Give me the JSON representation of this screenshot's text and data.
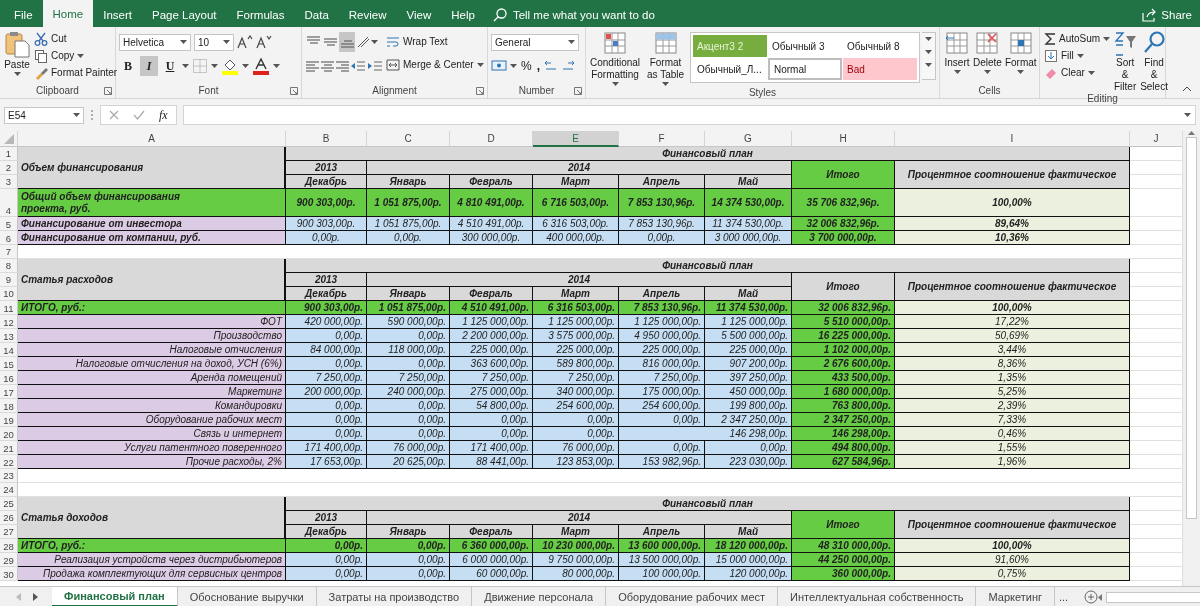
{
  "menu_tabs": [
    {
      "label": "File",
      "selected": false
    },
    {
      "label": "Home",
      "selected": true
    },
    {
      "label": "Insert",
      "selected": false
    },
    {
      "label": "Page Layout",
      "selected": false
    },
    {
      "label": "Formulas",
      "selected": false
    },
    {
      "label": "Data",
      "selected": false
    },
    {
      "label": "Review",
      "selected": false
    },
    {
      "label": "View",
      "selected": false
    },
    {
      "label": "Help",
      "selected": false
    }
  ],
  "tell_me": "Tell me what you want to do",
  "share": "Share",
  "ribbon": {
    "clipboard": {
      "label": "Clipboard",
      "paste": "Paste",
      "cut": "Cut",
      "copy": "Copy",
      "format_painter": "Format Painter"
    },
    "font": {
      "label": "Font",
      "family": "Helvetica",
      "size": "10",
      "styles": [
        {
          "text": "B",
          "kind": "bold",
          "selected": false
        },
        {
          "text": "I",
          "kind": "italic",
          "selected": true
        },
        {
          "text": "U",
          "kind": "underline",
          "selected": false
        }
      ]
    },
    "alignment": {
      "label": "Alignment",
      "vertical_align": [
        {
          "selected": false
        },
        {
          "selected": false
        },
        {
          "selected": true
        }
      ],
      "wrap_text": "Wrap Text",
      "merge_center": "Merge & Center"
    },
    "number": {
      "label": "Number",
      "format": "General",
      "percent": "%",
      "comma": ","
    },
    "styles": {
      "label": "Styles",
      "conditional": "Conditional Formatting",
      "format_table": "Format as Table",
      "gallery": [
        {
          "text": "Акцент3 2",
          "kind": "accent"
        },
        {
          "text": "Обычный 3",
          "kind": "plain"
        },
        {
          "text": "Обычный 8",
          "kind": "plain"
        },
        {
          "text": "Обычный_Л...",
          "kind": "plain"
        },
        {
          "text": "Normal",
          "kind": "normal"
        },
        {
          "text": "Bad",
          "kind": "bad"
        }
      ]
    },
    "cells": {
      "label": "Cells",
      "insert": "Insert",
      "delete": "Delete",
      "format": "Format"
    },
    "editing": {
      "label": "Editing",
      "autosum": "AutoSum",
      "fill": "Fill",
      "clear": "Clear",
      "sort": "Sort & Filter",
      "find": "Find & Select"
    }
  },
  "name_box": "E54",
  "fx": "fx",
  "columns": [
    {
      "label": "A",
      "selected": false
    },
    {
      "label": "B",
      "selected": false
    },
    {
      "label": "C",
      "selected": false
    },
    {
      "label": "D",
      "selected": false
    },
    {
      "label": "E",
      "selected": true
    },
    {
      "label": "F",
      "selected": false
    },
    {
      "label": "G",
      "selected": false
    },
    {
      "label": "H",
      "selected": false
    },
    {
      "label": "I",
      "selected": false
    },
    {
      "label": "J",
      "selected": false
    }
  ],
  "blocks": [
    {
      "header_rows": [
        "1",
        "2",
        "3"
      ],
      "title": "Объем финансирования",
      "plan": "Финансовый план",
      "years": [
        "2013",
        "2014"
      ],
      "months": [
        "Декабрь",
        "Январь",
        "Февраль",
        "Март",
        "Апрель",
        "Май"
      ],
      "total_header": "Итого",
      "total_highlight": true,
      "percent_header": "Процентное соотношение фактическое",
      "rows": [
        {
          "num": "4",
          "kind": "total",
          "tall": true,
          "label": "Общий объем финансирования проекта, руб.",
          "values": [
            "900 303,00р.",
            "1 051 875,00р.",
            "4 810 491,00р.",
            "6 716 503,00р.",
            "7 853 130,96р.",
            "14 374 530,00р."
          ],
          "total": "35 706 832,96р.",
          "percent": "100,00%"
        },
        {
          "num": "5",
          "kind": "source",
          "tall": false,
          "label": "Финансирование от инвестора",
          "values": [
            "900 303,00р.",
            "1 051 875,00р.",
            "4 510 491,00р.",
            "6 316 503,00р.",
            "7 853 130,96р.",
            "11 374 530,00р."
          ],
          "total": "32 006 832,96р.",
          "percent": "89,64%"
        },
        {
          "num": "6",
          "kind": "source",
          "tall": false,
          "label": "Финансирование от компании, руб.",
          "values": [
            "0,00р.",
            "0,00р.",
            "300 000,00р.",
            "400 000,00р.",
            "0,00р.",
            "3 000 000,00р."
          ],
          "total": "3 700 000,00р.",
          "percent": "10,36%"
        }
      ],
      "trailing_rows": [
        "7"
      ]
    },
    {
      "header_rows": [
        "8",
        "9",
        "10"
      ],
      "title": "Статья расходов",
      "plan": "Финансовый план",
      "years": [
        "2013",
        "2014"
      ],
      "months": [
        "Декабрь",
        "Январь",
        "Февраль",
        "Март",
        "Апрель",
        "Май"
      ],
      "total_header": "Итого",
      "total_highlight": false,
      "percent_header": "Процентное соотношение фактическое",
      "rows": [
        {
          "num": "11",
          "kind": "total",
          "tall": false,
          "label": "ИТОГО, руб.:",
          "values": [
            "900 303,00р.",
            "1 051 875,00р.",
            "4 510 491,00р.",
            "6 316 503,00р.",
            "7 853 130,96р.",
            "11 374 530,00р."
          ],
          "total": "32 006 832,96р.",
          "percent": "100,00%"
        },
        {
          "num": "12",
          "kind": "item",
          "tall": false,
          "label": "ФОТ",
          "values": [
            "420 000,00р.",
            "590 000,00р.",
            "1 125 000,00р.",
            "1 125 000,00р.",
            "1 125 000,00р.",
            "1 125 000,00р."
          ],
          "total": "5 510 000,00р.",
          "percent": "17,22%"
        },
        {
          "num": "13",
          "kind": "item",
          "tall": false,
          "label": "Производство",
          "values": [
            "0,00р.",
            "0,00р.",
            "2 200 000,00р.",
            "3 575 000,00р.",
            "4 950 000,00р.",
            "5 500 000,00р."
          ],
          "total": "16 225 000,00р.",
          "percent": "50,69%"
        },
        {
          "num": "14",
          "kind": "item",
          "tall": false,
          "label": "Налоговые отчисления",
          "values": [
            "84 000,00р.",
            "118 000,00р.",
            "225 000,00р.",
            "225 000,00р.",
            "225 000,00р.",
            "225 000,00р."
          ],
          "total": "1 102 000,00р.",
          "percent": "3,44%"
        },
        {
          "num": "15",
          "kind": "item",
          "tall": false,
          "label": "Налоговые отчисления на доход, УСН (6%)",
          "values": [
            "0,00р.",
            "0,00р.",
            "363 600,00р.",
            "589 800,00р.",
            "816 000,00р.",
            "907 200,00р."
          ],
          "total": "2 676 600,00р.",
          "percent": "8,36%"
        },
        {
          "num": "16",
          "kind": "item",
          "tall": false,
          "label": "Аренда помещений",
          "values": [
            "7 250,00р.",
            "7 250,00р.",
            "7 250,00р.",
            "7 250,00р.",
            "7 250,00р.",
            "397 250,00р."
          ],
          "total": "433 500,00р.",
          "percent": "1,35%"
        },
        {
          "num": "17",
          "kind": "item",
          "tall": false,
          "label": "Маркетинг",
          "values": [
            "200 000,00р.",
            "240 000,00р.",
            "275 000,00р.",
            "340 000,00р.",
            "175 000,00р.",
            "450 000,00р."
          ],
          "total": "1 680 000,00р.",
          "percent": "5,25%"
        },
        {
          "num": "18",
          "kind": "item",
          "tall": false,
          "label": "Командировки",
          "values": [
            "0,00р.",
            "0,00р.",
            "54 800,00р.",
            "254 600,00р.",
            "254 600,00р.",
            "199 800,00р."
          ],
          "total": "763 800,00р.",
          "percent": "2,39%"
        },
        {
          "num": "19",
          "kind": "item",
          "tall": false,
          "label": "Оборудование рабочих мест",
          "values": [
            "0,00р.",
            "0,00р.",
            "0,00р.",
            "0,00р.",
            "0,00р.",
            "2 347 250,00р."
          ],
          "total": "2 347 250,00р.",
          "percent": "7,33%"
        },
        {
          "num": "20",
          "kind": "item",
          "tall": false,
          "label": "Связь и интернет",
          "values": [
            "0,00р.",
            "0,00р.",
            "0,00р.",
            "0,00р.",
            "146 298,00р."
          ],
          "total": "146 298,00р.",
          "percent": "0,46%"
        },
        {
          "num": "21",
          "kind": "item",
          "tall": false,
          "label": "Услуги патентного поверенного",
          "values": [
            "171 400,00р.",
            "76 000,00р.",
            "171 400,00р.",
            "76 000,00р.",
            "0,00р.",
            "0,00р."
          ],
          "total": "494 800,00р.",
          "percent": "1,55%"
        },
        {
          "num": "22",
          "kind": "item",
          "tall": false,
          "label": "Прочие  расходы, 2%",
          "values": [
            "17 653,00р.",
            "20 625,00р.",
            "88 441,00р.",
            "123 853,00р.",
            "153 982,96р.",
            "223 030,00р."
          ],
          "total": "627 584,96р.",
          "percent": "1,96%"
        }
      ],
      "trailing_rows": [
        "23",
        "24"
      ]
    },
    {
      "header_rows": [
        "25",
        "26",
        "27"
      ],
      "title": "Статья доходов",
      "plan": "Финансовый план",
      "years": [
        "2013",
        "2014"
      ],
      "months": [
        "Декабрь",
        "Январь",
        "Февраль",
        "Март",
        "Апрель",
        "Май"
      ],
      "total_header": "Итого",
      "total_highlight": true,
      "percent_header": "Процентное соотношение фактическое",
      "rows": [
        {
          "num": "28",
          "kind": "total",
          "tall": false,
          "label": "ИТОГО, руб.:",
          "values": [
            "0,00р.",
            "0,00р.",
            "6 360 000,00р.",
            "10 230 000,00р.",
            "13 600 000,00р.",
            "18 120 000,00р."
          ],
          "total": "48 310 000,00р.",
          "percent": "100,00%"
        },
        {
          "num": "29",
          "kind": "item",
          "tall": false,
          "label": "Реализация устройств через дистрибьютеров",
          "values": [
            "0,00р.",
            "0,00р.",
            "6 000 000,00р.",
            "9 750 000,00р.",
            "13 500 000,00р.",
            "15 000 000,00р."
          ],
          "total": "44 250 000,00р.",
          "percent": "91,60%"
        },
        {
          "num": "30",
          "kind": "item",
          "tall": false,
          "label": "Продажа комплектующих для сервисных центров",
          "values": [
            "0,00р.",
            "0,00р.",
            "60 000,00р.",
            "80 000,00р.",
            "100 000,00р.",
            "120 000,00р."
          ],
          "total": "360 000,00р.",
          "percent": "0,75%"
        }
      ]
    }
  ],
  "sheet_tabs": [
    {
      "label": "Финансовый план",
      "selected": true
    },
    {
      "label": "Обоснование выручки",
      "selected": false
    },
    {
      "label": "Затраты на производство",
      "selected": false
    },
    {
      "label": "Движение персонала",
      "selected": false
    },
    {
      "label": "Оборудование рабочих мест",
      "selected": false
    },
    {
      "label": "Интеллектуальная собственность",
      "selected": false
    },
    {
      "label": "Маркетинг",
      "selected": false
    }
  ],
  "more_tabs": "..."
}
